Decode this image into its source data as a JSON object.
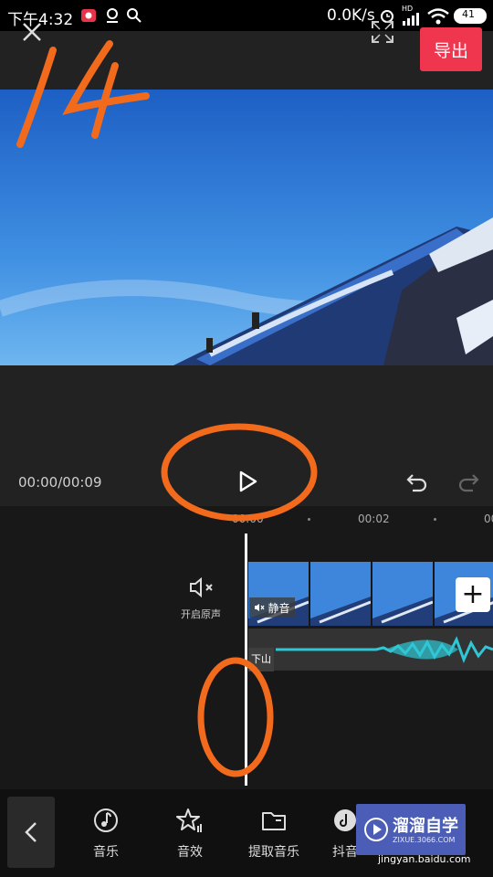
{
  "status_bar": {
    "time": "下午4:32",
    "speed": "0.0K/s",
    "hd": "HD",
    "battery": "41"
  },
  "top_bar": {
    "export_label": "导出"
  },
  "player": {
    "time": "00:00/00:09"
  },
  "timeline": {
    "ruler": [
      "00:00",
      "00:02",
      "00:0"
    ],
    "original_sound_label": "开启原声",
    "mute_badge": "静音",
    "audio_clip_label": "下山"
  },
  "toolbar": {
    "items": [
      {
        "label": "音乐",
        "icon": "music-note-icon"
      },
      {
        "label": "音效",
        "icon": "sound-effect-icon"
      },
      {
        "label": "提取音乐",
        "icon": "folder-icon"
      },
      {
        "label": "抖音",
        "icon": "douyin-icon"
      }
    ]
  },
  "watermark": {
    "title": "溜溜自学",
    "subtitle": "ZIXUE.3066.COM",
    "site": "jingyan.baidu.com"
  },
  "annotations": {
    "handwritten_number": "14"
  }
}
